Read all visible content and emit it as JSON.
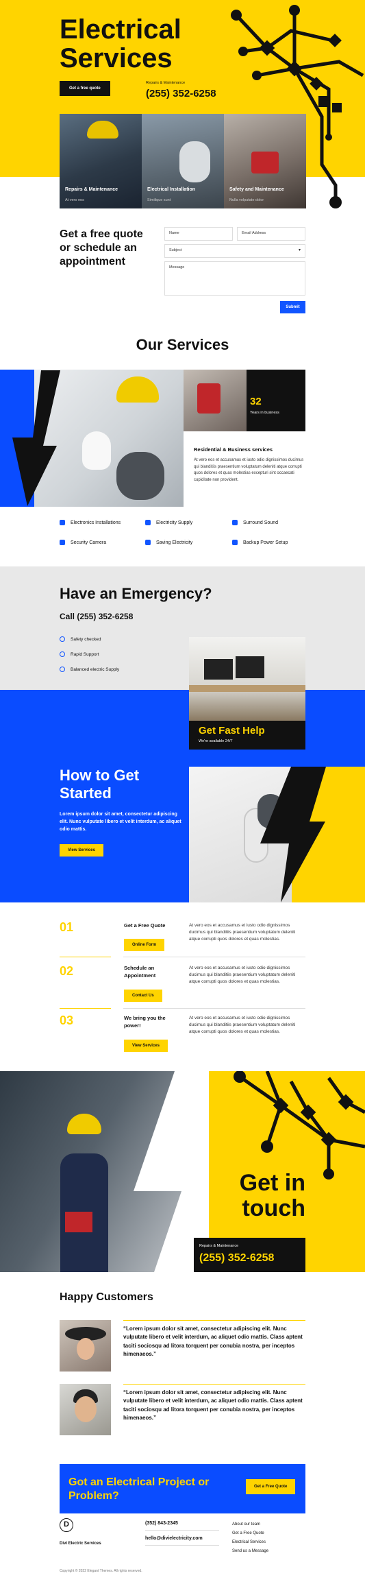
{
  "hero": {
    "title_line1": "Electrical",
    "title_line2": "Services",
    "cta": "Get a free quote",
    "phone_label": "Repairs & Maintenance",
    "phone": "(255) 352-6258",
    "cards": [
      {
        "title": "Repairs & Maintenance",
        "sub": "At vero eos"
      },
      {
        "title": "Electrical Installation",
        "sub": "Similique sunt"
      },
      {
        "title": "Safety and Maintenance",
        "sub": "Nulla volputate dolor"
      }
    ]
  },
  "quote_form": {
    "heading": "Get a free quote or schedule an appointment",
    "name_placeholder": "Name",
    "email_placeholder": "Email Address",
    "subject": "Subject",
    "message_placeholder": "Message",
    "submit": "Submit"
  },
  "services": {
    "heading": "Our Services",
    "years": "32",
    "years_label": "Years in business",
    "subheading": "Residential & Business services",
    "body": "At vero eos et accusamus et iusto odio dignissimos ducimus qui blanditiis praesentium voluptatum deleniti atque corrupti quos dolores et quas molestias excepturi sint occaecati cupiditate non provident.",
    "items": [
      "Electronics Installations",
      "Electricity Supply",
      "Surround Sound",
      "Security Camera",
      "Saving Electricity",
      "Backup Power Setup"
    ]
  },
  "emergency": {
    "heading": "Have an Emergency?",
    "phone": "Call (255) 352-6258",
    "checks": [
      "Safety checked",
      "Rapid Support",
      "Balanced electric Supply"
    ],
    "help_title": "Get Fast Help",
    "help_sub": "We're available 24/7"
  },
  "started": {
    "heading": "How to Get Started",
    "body": "Lorem ipsum dolor sit amet, consectetur adipiscing elit. Nunc vulputate libero et velit interdum, ac aliquet odio mattis.",
    "cta": "View Services",
    "steps": [
      {
        "num": "01",
        "title": "Get a Free Quote",
        "btn": "Online Form",
        "text": "At vero eos et accusamus et iusto odio dignissimos ducimus qui blanditiis praesentium voluptatum deleniti atque corrupti quos dolores et quas molestias."
      },
      {
        "num": "02",
        "title": "Schedule an Appointment",
        "btn": "Contact Us",
        "text": "At vero eos et accusamus et iusto odio dignissimos ducimus qui blanditiis praesentium voluptatum deleniti atque corrupti quos dolores et quas molestias."
      },
      {
        "num": "03",
        "title": "We bring you the power!",
        "btn": "View Services",
        "text": "At vero eos et accusamus et iusto odio dignissimos ducimus qui blanditiis praesentium voluptatum deleniti atque corrupti quos dolores et quas molestias."
      }
    ]
  },
  "contact": {
    "heading_line1": "Get in",
    "heading_line2": "touch",
    "label": "Repairs & Maintenance",
    "phone": "(255) 352-6258"
  },
  "testimonials": {
    "heading": "Happy Customers",
    "quotes": [
      "“Lorem ipsum dolor sit amet, consectetur adipiscing elit. Nunc vulputate libero et velit interdum, ac aliquet odio mattis. Class aptent taciti sociosqu ad litora torquent per conubia nostra, per inceptos himenaeos.”",
      "“Lorem ipsum dolor sit amet, consectetur adipiscing elit. Nunc vulputate libero et velit interdum, ac aliquet odio mattis. Class aptent taciti sociosqu ad litora torquent per conubia nostra, per inceptos himenaeos.”"
    ]
  },
  "cta_banner": {
    "heading": "Got an Electrical Project or Problem?",
    "button": "Get a Free Quote"
  },
  "footer": {
    "logo_letter": "D",
    "brand": "Divi Electric Services",
    "phone": "(352) 843-2345",
    "email": "hello@divielectricity.com",
    "links": [
      "About our team",
      "Get a Free Quote",
      "Electrical Services",
      "Send us a Message"
    ],
    "copyright": "Copyright © 2022 Elegant Themes. All rights reserved."
  },
  "colors": {
    "yellow": "#ffd400",
    "blue": "#0a4cff",
    "black": "#111111"
  }
}
